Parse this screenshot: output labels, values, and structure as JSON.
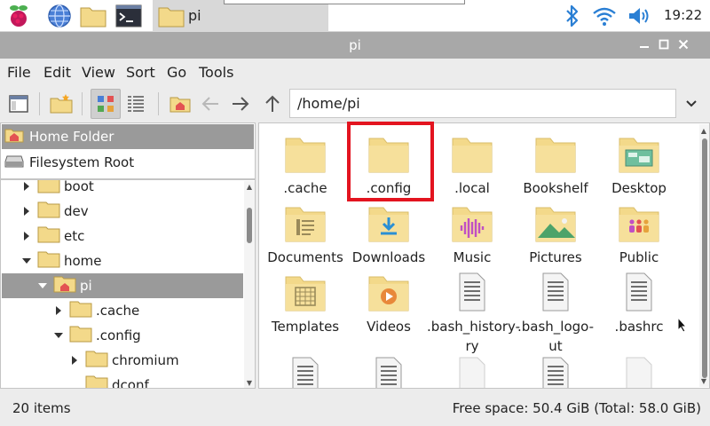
{
  "taskbar": {
    "task_label": "pi",
    "clock": "19:22",
    "icons": [
      "raspberry-menu-icon",
      "web-browser-icon",
      "file-manager-icon",
      "terminal-icon",
      "bluetooth-icon",
      "wifi-icon",
      "volume-icon"
    ]
  },
  "window": {
    "title": "pi"
  },
  "menu": [
    "File",
    "Edit",
    "View",
    "Sort",
    "Go",
    "Tools"
  ],
  "toolbar": {
    "path": "/home/pi"
  },
  "places": [
    {
      "label": "Home Folder",
      "selected": true
    },
    {
      "label": "Filesystem Root",
      "selected": false
    }
  ],
  "tree": [
    {
      "label": "boot",
      "depth": 0,
      "expanded": false
    },
    {
      "label": "dev",
      "depth": 0,
      "expanded": false
    },
    {
      "label": "etc",
      "depth": 0,
      "expanded": false
    },
    {
      "label": "home",
      "depth": 0,
      "expanded": true
    },
    {
      "label": "pi",
      "depth": 1,
      "expanded": true,
      "selected": true,
      "home": true
    },
    {
      "label": ".cache",
      "depth": 2,
      "expanded": false
    },
    {
      "label": ".config",
      "depth": 2,
      "expanded": true
    },
    {
      "label": "chromium",
      "depth": 3,
      "expanded": false
    },
    {
      "label": "dconf",
      "depth": 3,
      "expanded": null
    }
  ],
  "files": [
    {
      "label": ".cache",
      "icon": "folder"
    },
    {
      "label": ".config",
      "icon": "folder",
      "highlighted": true
    },
    {
      "label": ".local",
      "icon": "folder"
    },
    {
      "label": "Bookshelf",
      "icon": "folder"
    },
    {
      "label": "Desktop",
      "icon": "desktop-folder"
    },
    {
      "label": "Documents",
      "icon": "documents-folder"
    },
    {
      "label": "Downloads",
      "icon": "downloads-folder"
    },
    {
      "label": "Music",
      "icon": "music-folder"
    },
    {
      "label": "Pictures",
      "icon": "pictures-folder"
    },
    {
      "label": "Public",
      "icon": "public-folder"
    },
    {
      "label": "Templates",
      "icon": "templates-folder"
    },
    {
      "label": "Videos",
      "icon": "videos-folder"
    },
    {
      "label": ".bash_history",
      "display": ".bash_history-\nry",
      "icon": "text-file"
    },
    {
      "label": ".bash_logout",
      "display": ".bash_logo-\nut",
      "icon": "text-file"
    },
    {
      "label": ".bashrc",
      "icon": "text-file"
    },
    {
      "label": "",
      "icon": "text-file"
    },
    {
      "label": "",
      "icon": "text-file"
    },
    {
      "label": "",
      "icon": "blank-file"
    },
    {
      "label": "",
      "icon": "text-file"
    },
    {
      "label": "",
      "icon": "blank-file"
    }
  ],
  "status": {
    "item_count": "20 items",
    "free_space": "Free space: 50.4 GiB (Total: 58.0 GiB)"
  },
  "colors": {
    "folder": "#f3d98a",
    "folder_dark": "#e6c66b",
    "selection": "#9a9a9a",
    "highlight": "#e3141f"
  }
}
